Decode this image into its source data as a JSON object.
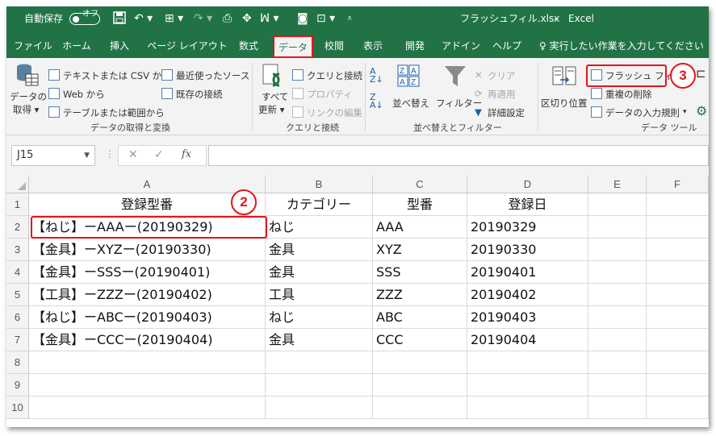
{
  "titlebar": {
    "autosave_label": "自動保存",
    "toggle_state": "オフ",
    "filename": "フラッシュフィル.xlsx",
    "separator": "-",
    "app_name": "Excel"
  },
  "tabs": [
    "ファイル",
    "ホーム",
    "挿入",
    "ページ レイアウト",
    "数式",
    "データ",
    "校閲",
    "表示",
    "開発",
    "アドイン",
    "ヘルプ"
  ],
  "active_tab": "データ",
  "tell_me": "実行したい作業を入力してください",
  "ribbon": {
    "get_data": {
      "big_button": [
        "データの",
        "取得 ▾"
      ],
      "items": [
        "テキストまたは CSV から",
        "Web から",
        "テーブルまたは範囲から",
        "最近使ったソース",
        "既存の接続"
      ],
      "group_label": "データの取得と変換"
    },
    "queries": {
      "big_button": [
        "すべて",
        "更新 ▾"
      ],
      "items": [
        "クエリと接続",
        "プロパティ",
        "リンクの編集"
      ],
      "group_label": "クエリと接続"
    },
    "sort_filter": {
      "sort": "並べ替え",
      "filter": "フィルター",
      "items": [
        "クリア",
        "再適用",
        "詳細設定"
      ],
      "group_label": "並べ替えとフィルター"
    },
    "data_tools": {
      "text_to_columns": "区切り位置",
      "items": [
        "フラッシュ フィル",
        "重複の削除",
        "データの入力規則"
      ],
      "group_label": "データ ツール"
    }
  },
  "formula_bar": {
    "name_box": "J15",
    "fx": "fx",
    "content": ""
  },
  "callouts": [
    "2",
    "3"
  ],
  "columns": [
    "A",
    "B",
    "C",
    "D",
    "E",
    "F"
  ],
  "rows": [
    [
      "登録型番",
      "カテゴリー",
      "型番",
      "登録日",
      "",
      ""
    ],
    [
      "【ねじ】ーAAAー(20190329)",
      "ねじ",
      "AAA",
      "20190329",
      "",
      ""
    ],
    [
      "【金具】ーXYZー(20190330)",
      "金具",
      "XYZ",
      "20190330",
      "",
      ""
    ],
    [
      "【金具】ーSSSー(20190401)",
      "金具",
      "SSS",
      "20190401",
      "",
      ""
    ],
    [
      "【工具】ーZZZー(20190402)",
      "工具",
      "ZZZ",
      "20190402",
      "",
      ""
    ],
    [
      "【ねじ】ーABCー(20190403)",
      "ねじ",
      "ABC",
      "20190403",
      "",
      ""
    ],
    [
      "【金具】ーCCCー(20190404)",
      "金具",
      "CCC",
      "20190404",
      "",
      ""
    ],
    [
      "",
      "",
      "",
      "",
      "",
      ""
    ],
    [
      "",
      "",
      "",
      "",
      "",
      ""
    ],
    [
      "",
      "",
      "",
      "",
      "",
      ""
    ]
  ],
  "colors": {
    "excel_green": "#217346",
    "highlight_red": "#e0161b"
  }
}
